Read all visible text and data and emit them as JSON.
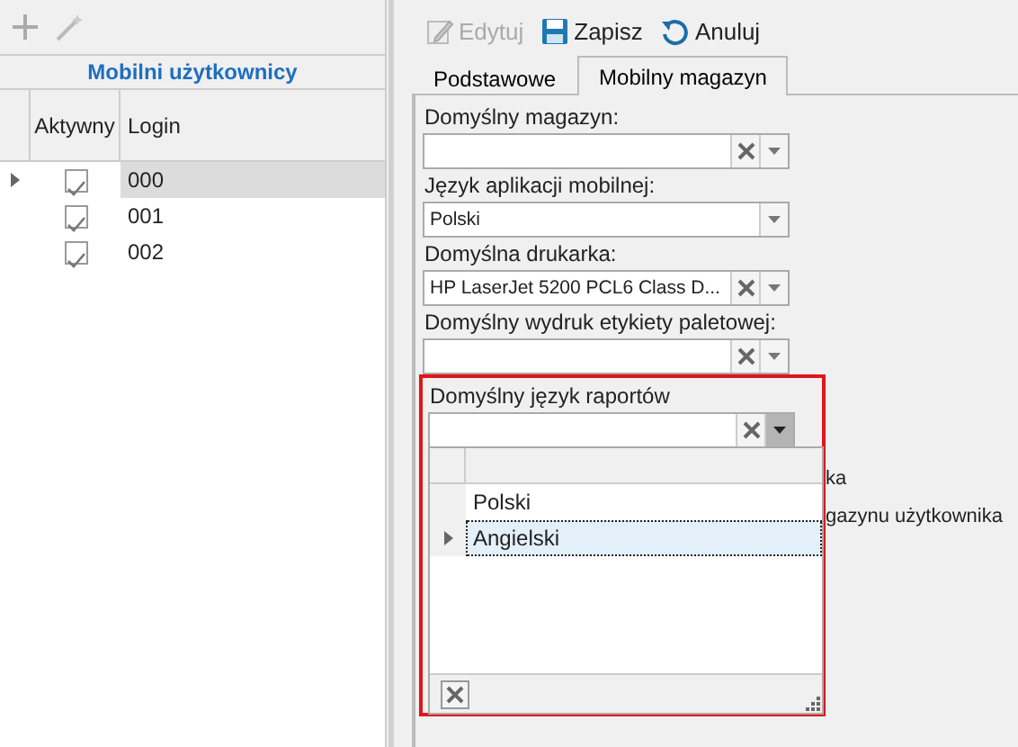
{
  "left_toolbar": [
    {
      "kind": "add"
    },
    {
      "kind": "wand"
    }
  ],
  "users": {
    "title": "Mobilni użytkownicy",
    "columns": [
      "Aktywny",
      "Login"
    ],
    "rows": [
      {
        "active": true,
        "login": "000",
        "selected": true
      },
      {
        "active": true,
        "login": "001",
        "selected": false
      },
      {
        "active": true,
        "login": "002",
        "selected": false
      }
    ]
  },
  "toolbar": [
    {
      "kind": "edit",
      "label": "Edytuj",
      "disabled": true
    },
    {
      "kind": "save",
      "label": "Zapisz",
      "disabled": false
    },
    {
      "kind": "undo",
      "label": "Anuluj",
      "disabled": false
    }
  ],
  "tabs": [
    {
      "label": "Podstawowe",
      "selected": false
    },
    {
      "label": "Mobilny magazyn",
      "selected": true
    }
  ],
  "fields": [
    {
      "label": "Domyślny magazyn:",
      "clearable": true,
      "highlighted": false,
      "open": false
    },
    {
      "label": "Język aplikacji mobilnej:",
      "value": "Polski",
      "clearable": false,
      "highlighted": false,
      "open": false
    },
    {
      "label": "Domyślna drukarka:",
      "value": "HP LaserJet 5200 PCL6 Class D...",
      "clearable": true,
      "highlighted": false,
      "open": false
    },
    {
      "label": "Domyślny wydruk etykiety paletowej:",
      "clearable": true,
      "highlighted": false,
      "open": false
    },
    {
      "label": "Domyślny język raportów",
      "clearable": true,
      "highlighted": true,
      "open": true
    }
  ],
  "dropdown": {
    "options": [
      {
        "label": "Polski",
        "selected": false
      },
      {
        "label": "Angielski",
        "selected": true
      }
    ]
  },
  "obscured_texts": [
    "ka",
    "gazynu użytkownika"
  ]
}
